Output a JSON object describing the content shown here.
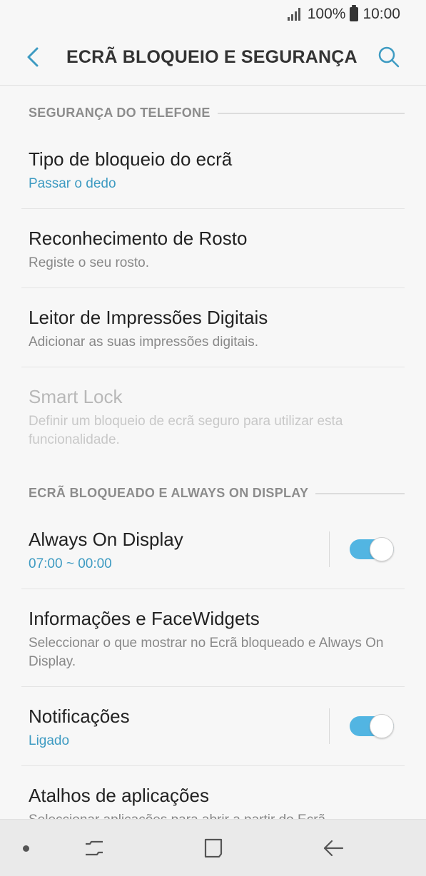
{
  "status_bar": {
    "battery": "100%",
    "time": "10:00"
  },
  "header": {
    "title": "ECRÃ BLOQUEIO E SEGURANÇA"
  },
  "sections": [
    {
      "label": "SEGURANÇA DO TELEFONE"
    },
    {
      "label": "ECRÃ BLOQUEADO E ALWAYS ON DISPLAY"
    }
  ],
  "items": [
    {
      "title": "Tipo de bloqueio do ecrã",
      "subtitle": "Passar o dedo"
    },
    {
      "title": "Reconhecimento de Rosto",
      "subtitle": "Registe o seu rosto."
    },
    {
      "title": "Leitor de Impressões Digitais",
      "subtitle": "Adicionar as suas impressões digitais."
    },
    {
      "title": "Smart Lock",
      "subtitle": "Definir um bloqueio de ecrã seguro para utilizar esta funcionalidade."
    },
    {
      "title": "Always On Display",
      "subtitle": "07:00 ~ 00:00",
      "toggle_on": true
    },
    {
      "title": "Informações e FaceWidgets",
      "subtitle": "Seleccionar o que mostrar no Ecrã bloqueado e Always On Display."
    },
    {
      "title": "Notificações",
      "subtitle": "Ligado",
      "toggle_on": true
    },
    {
      "title": "Atalhos de aplicações",
      "subtitle": "Seleccionar aplicações para abrir a partir do Ecrã"
    }
  ],
  "colors": {
    "accent": "#3e9bc2",
    "toggle_on": "#52b5e2",
    "header_text": "#333333"
  }
}
